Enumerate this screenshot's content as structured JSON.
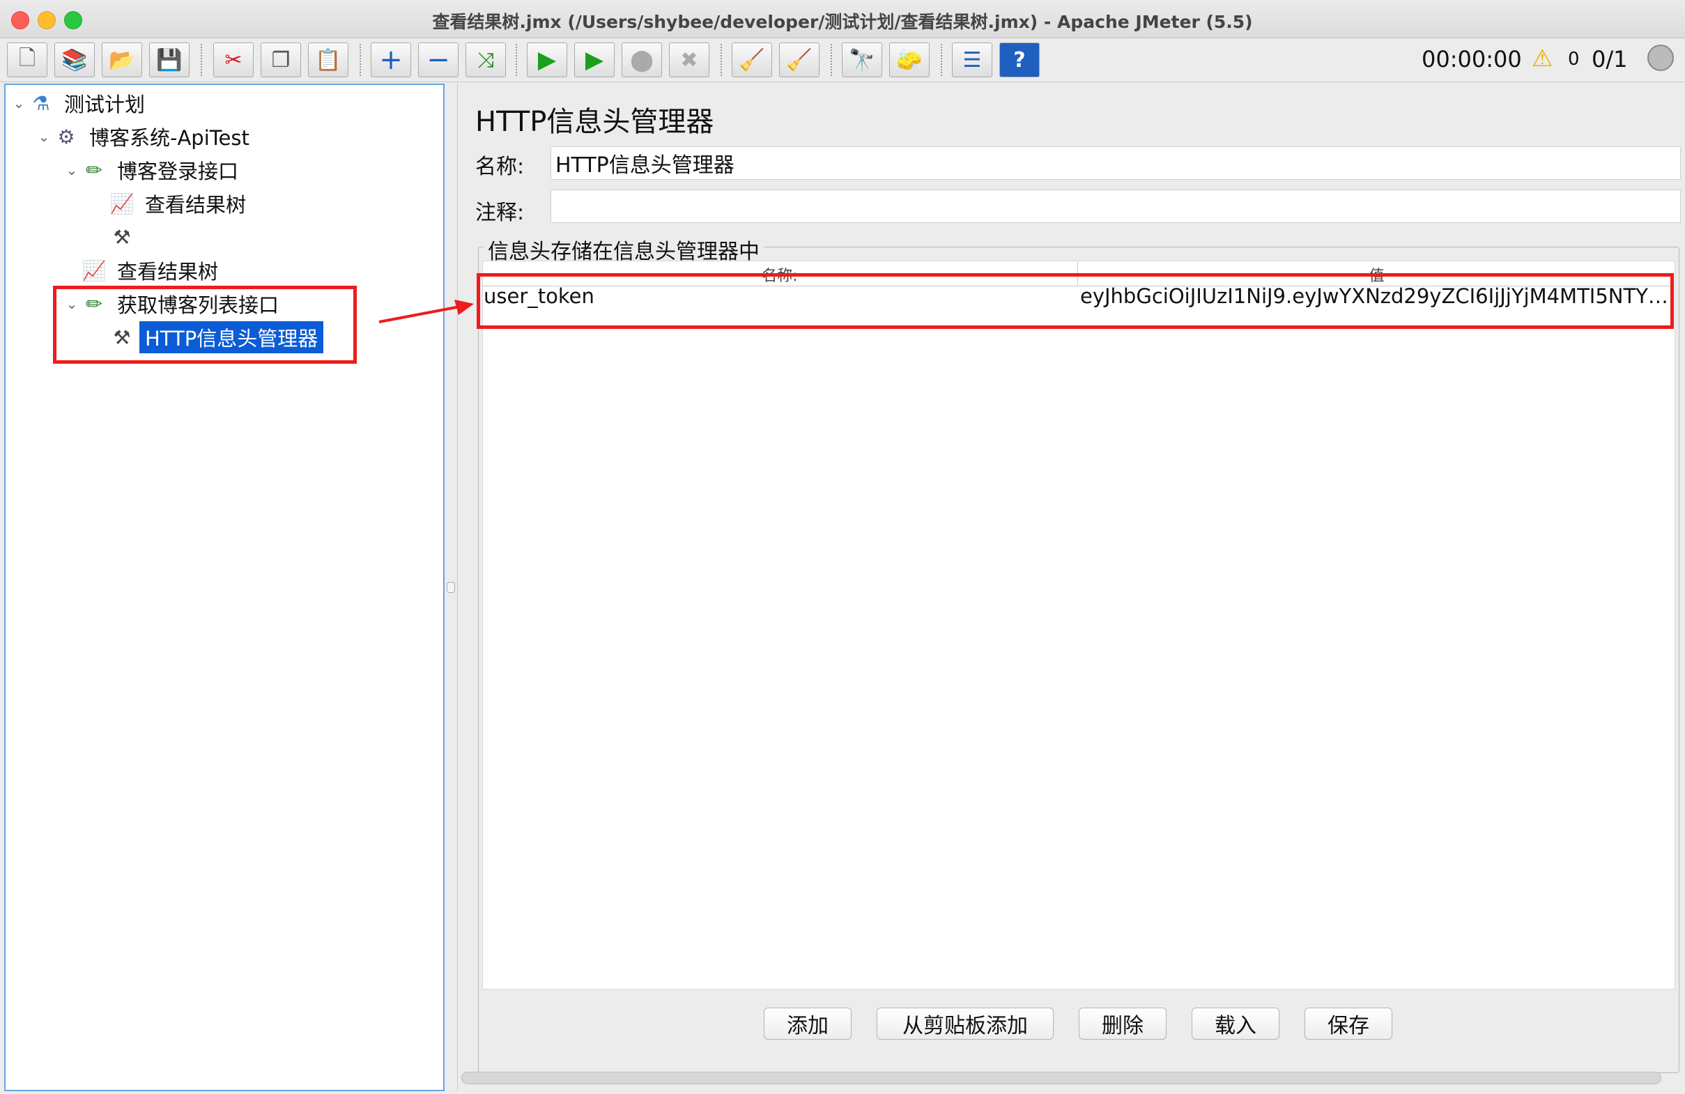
{
  "window": {
    "title": "查看结果树.jmx (/Users/shybee/developer/测试计划/查看结果树.jmx) - Apache JMeter (5.5)"
  },
  "toolbar": {
    "buttons": [
      {
        "name": "new-icon",
        "glyph": "🗋"
      },
      {
        "name": "templates-icon",
        "glyph": "📚"
      },
      {
        "name": "open-icon",
        "glyph": "📂"
      },
      {
        "name": "save-icon",
        "glyph": "💾"
      },
      {
        "name": "cut-icon",
        "glyph": "✂"
      },
      {
        "name": "copy-icon",
        "glyph": "❐"
      },
      {
        "name": "paste-icon",
        "glyph": "📋"
      },
      {
        "name": "expand-icon",
        "glyph": "+"
      },
      {
        "name": "collapse-icon",
        "glyph": "−"
      },
      {
        "name": "toggle-icon",
        "glyph": "⤨"
      },
      {
        "name": "start-icon",
        "glyph": "▶"
      },
      {
        "name": "start-no-pause-icon",
        "glyph": "▶"
      },
      {
        "name": "stop-icon",
        "glyph": "⬤"
      },
      {
        "name": "shutdown-icon",
        "glyph": "✖"
      },
      {
        "name": "clear-icon",
        "glyph": "🧹"
      },
      {
        "name": "clear-all-icon",
        "glyph": "🧹"
      },
      {
        "name": "search-icon",
        "glyph": "🔭"
      },
      {
        "name": "reset-search-icon",
        "glyph": "🧽"
      },
      {
        "name": "function-helper-icon",
        "glyph": "☰"
      },
      {
        "name": "help-icon",
        "glyph": "?"
      }
    ]
  },
  "status": {
    "time": "00:00:00",
    "warning_count": "0",
    "threads": "0/1"
  },
  "tree": {
    "nodes": [
      {
        "label": "测试计划"
      },
      {
        "label": "博客系统-ApiTest"
      },
      {
        "label": "博客登录接口"
      },
      {
        "label": "查看结果树"
      },
      {
        "label": ""
      },
      {
        "label": "查看结果树"
      },
      {
        "label": "获取博客列表接口"
      },
      {
        "label": "HTTP信息头管理器"
      }
    ]
  },
  "panel": {
    "title": "HTTP信息头管理器",
    "name_label": "名称:",
    "name_value": "HTTP信息头管理器",
    "comment_label": "注释:",
    "comment_value": "",
    "group_title": "信息头存储在信息头管理器中"
  },
  "table": {
    "columns": [
      "名称:",
      "值"
    ],
    "rows": [
      {
        "name": "user_token",
        "value": "eyJhbGciOiJIUzI1NiJ9.eyJwYXNzd29yZCI6IjJjYjM4MTI5NTYx..."
      }
    ]
  },
  "buttons": {
    "add": "添加",
    "add_clipboard": "从剪贴板添加",
    "delete": "删除",
    "load": "载入",
    "save": "保存"
  },
  "colors": {
    "selection": "#0b5cd6",
    "annotation_red": "#ee1c1c"
  }
}
